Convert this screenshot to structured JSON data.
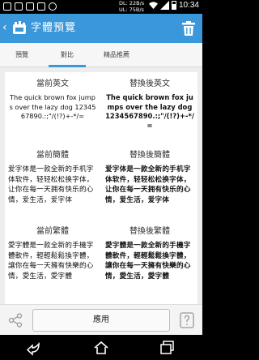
{
  "status_bar": {
    "download": "DL: 22B/s",
    "upload": "UL: 75B/s",
    "time": "10:34"
  },
  "app_bar": {
    "title": "字體預覽"
  },
  "tabs": [
    {
      "label": "預覽",
      "active": false
    },
    {
      "label": "對比",
      "active": true
    },
    {
      "label": "精品推薦",
      "active": false
    }
  ],
  "comparison": {
    "english": {
      "current_heading": "當前英文",
      "replaced_heading": "替換後英文",
      "sample": "The quick brown fox jumps over the lazy dog 1234567890.:;\"/(!?)+-*/="
    },
    "simplified": {
      "current_heading": "當前簡體",
      "replaced_heading": "替換後簡體",
      "sample": "爱字体是一款全新的手机字体软件，轻轻松松换字体，让你在每一天拥有快乐的心情，爱生活，爱字体"
    },
    "traditional": {
      "current_heading": "當前繁體",
      "replaced_heading": "替換後繁體",
      "sample": "愛字體是一款全新的手機字體軟件，輕輕鬆鬆換字體，讓你在每一天擁有快樂的心情，愛生活，愛字體"
    }
  },
  "bottom_bar": {
    "apply_label": "應用"
  },
  "colors": {
    "accent": "#3a97d9"
  }
}
